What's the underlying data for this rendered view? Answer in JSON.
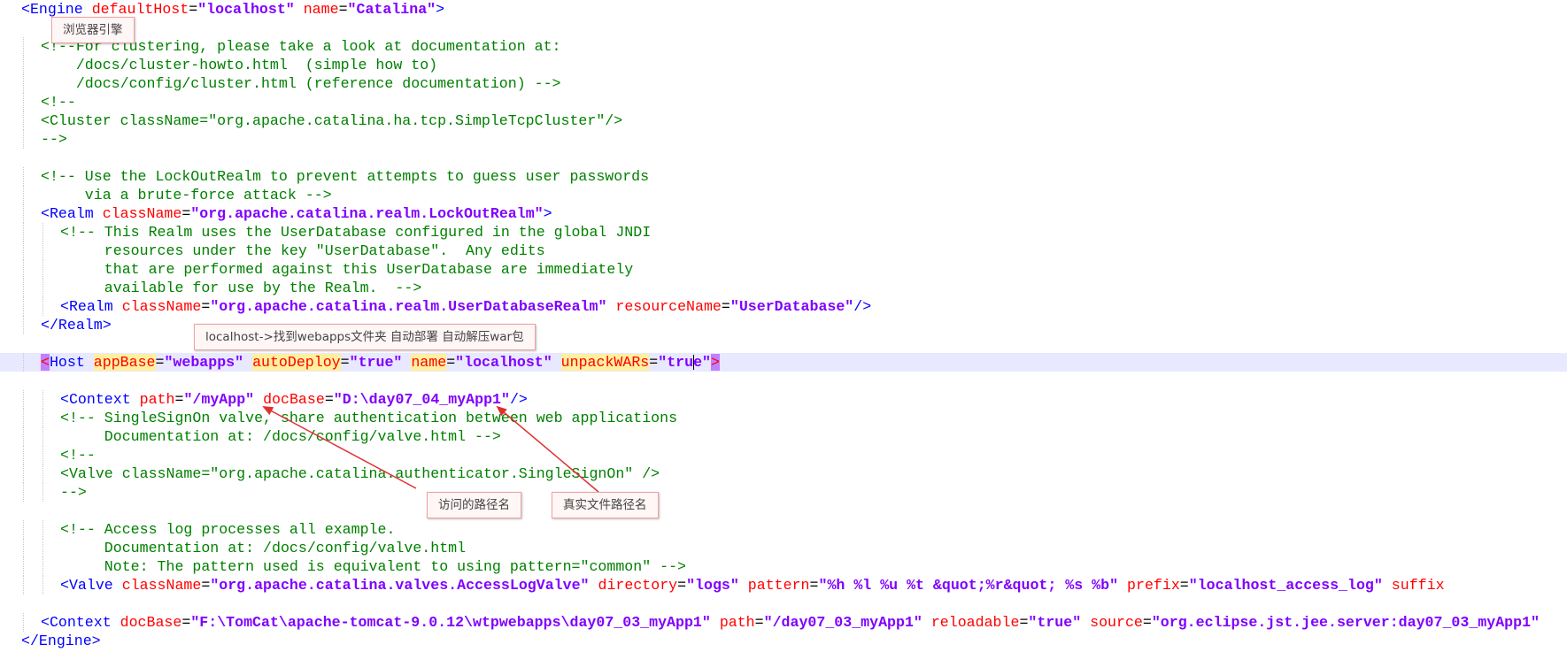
{
  "colors": {
    "tag": "#0000ff",
    "attribute": "#ff0000",
    "value": "#8000ff",
    "comment": "#008000",
    "current_line_bg": "#e8e8ff",
    "annotation_border": "#f0a0a0",
    "arrow": "#e03030"
  },
  "editor": {
    "lines": [
      {
        "tokens": [
          [
            "tag",
            "<Engine"
          ],
          [
            "p",
            " "
          ],
          [
            "attr",
            "defaultHost"
          ],
          [
            "p",
            "="
          ],
          [
            "val",
            "\"localhost\""
          ],
          [
            "p",
            " "
          ],
          [
            "attr",
            "name"
          ],
          [
            "p",
            "="
          ],
          [
            "val",
            "\"Catalina\""
          ],
          [
            "tag",
            ">"
          ]
        ]
      },
      {
        "tokens": []
      },
      {
        "tokens": [
          [
            "comment",
            "<!--For clustering, please take a look at documentation at:"
          ]
        ]
      },
      {
        "tokens": [
          [
            "comment",
            "    /docs/cluster-howto.html  (simple how to)"
          ]
        ]
      },
      {
        "tokens": [
          [
            "comment",
            "    /docs/config/cluster.html (reference documentation) -->"
          ]
        ]
      },
      {
        "tokens": [
          [
            "comment",
            "<!--"
          ]
        ]
      },
      {
        "tokens": [
          [
            "comment",
            "<Cluster className=\"org.apache.catalina.ha.tcp.SimpleTcpCluster\"/>"
          ]
        ]
      },
      {
        "tokens": [
          [
            "comment",
            "-->"
          ]
        ]
      },
      {
        "tokens": []
      },
      {
        "tokens": [
          [
            "comment",
            "<!-- Use the LockOutRealm to prevent attempts to guess user passwords"
          ]
        ]
      },
      {
        "tokens": [
          [
            "comment",
            "     via a brute-force attack -->"
          ]
        ]
      },
      {
        "tokens": [
          [
            "tag",
            "<Realm"
          ],
          [
            "p",
            " "
          ],
          [
            "attr",
            "className"
          ],
          [
            "p",
            "="
          ],
          [
            "val",
            "\"org.apache.catalina.realm.LockOutRealm\""
          ],
          [
            "tag",
            ">"
          ]
        ]
      },
      {
        "tokens": [
          [
            "comment",
            "<!-- This Realm uses the UserDatabase configured in the global JNDI"
          ]
        ]
      },
      {
        "tokens": [
          [
            "comment",
            "     resources under the key \"UserDatabase\".  Any edits"
          ]
        ]
      },
      {
        "tokens": [
          [
            "comment",
            "     that are performed against this UserDatabase are immediately"
          ]
        ]
      },
      {
        "tokens": [
          [
            "comment",
            "     available for use by the Realm.  -->"
          ]
        ]
      },
      {
        "tokens": [
          [
            "tag",
            "<Realm"
          ],
          [
            "p",
            " "
          ],
          [
            "attr",
            "className"
          ],
          [
            "p",
            "="
          ],
          [
            "val",
            "\"org.apache.catalina.realm.UserDatabaseRealm\""
          ],
          [
            "p",
            " "
          ],
          [
            "attr",
            "resourceName"
          ],
          [
            "p",
            "="
          ],
          [
            "val",
            "\"UserDatabase\""
          ],
          [
            "tag",
            "/>"
          ]
        ]
      },
      {
        "tokens": [
          [
            "tag",
            "</Realm>"
          ]
        ]
      },
      {
        "tokens": []
      },
      {
        "tokens": [
          [
            "brace",
            "<"
          ],
          [
            "tag",
            "Host"
          ],
          [
            "p",
            " "
          ],
          [
            "hlattr",
            "appBase"
          ],
          [
            "p",
            "="
          ],
          [
            "val",
            "\"webapps\""
          ],
          [
            "p",
            " "
          ],
          [
            "hlattr",
            "autoDeploy"
          ],
          [
            "p",
            "="
          ],
          [
            "val",
            "\"true\""
          ],
          [
            "p",
            " "
          ],
          [
            "hlattr",
            "name"
          ],
          [
            "p",
            "="
          ],
          [
            "val",
            "\"localhost\""
          ],
          [
            "p",
            " "
          ],
          [
            "hlattr",
            "unpackWARs"
          ],
          [
            "p",
            "="
          ],
          [
            "val",
            "\"true\""
          ],
          [
            "brace",
            ">"
          ]
        ]
      },
      {
        "tokens": []
      },
      {
        "tokens": [
          [
            "tag",
            "<Context"
          ],
          [
            "p",
            " "
          ],
          [
            "attr",
            "path"
          ],
          [
            "p",
            "="
          ],
          [
            "val",
            "\"/myApp\""
          ],
          [
            "p",
            " "
          ],
          [
            "attr",
            "docBase"
          ],
          [
            "p",
            "="
          ],
          [
            "val",
            "\"D:\\day07_04_myApp1\""
          ],
          [
            "tag",
            "/>"
          ]
        ]
      },
      {
        "tokens": [
          [
            "comment",
            "<!-- SingleSignOn valve, share authentication between web applications"
          ]
        ]
      },
      {
        "tokens": [
          [
            "comment",
            "     Documentation at: /docs/config/valve.html -->"
          ]
        ]
      },
      {
        "tokens": [
          [
            "comment",
            "<!--"
          ]
        ]
      },
      {
        "tokens": [
          [
            "comment",
            "<Valve className=\"org.apache.catalina.authenticator.SingleSignOn\" />"
          ]
        ]
      },
      {
        "tokens": [
          [
            "comment",
            "-->"
          ]
        ]
      },
      {
        "tokens": []
      },
      {
        "tokens": [
          [
            "comment",
            "<!-- Access log processes all example."
          ]
        ]
      },
      {
        "tokens": [
          [
            "comment",
            "     Documentation at: /docs/config/valve.html"
          ]
        ]
      },
      {
        "tokens": [
          [
            "comment",
            "     Note: The pattern used is equivalent to using pattern=\"common\" -->"
          ]
        ]
      },
      {
        "tokens": [
          [
            "tag",
            "<Valve"
          ],
          [
            "p",
            " "
          ],
          [
            "attr",
            "className"
          ],
          [
            "p",
            "="
          ],
          [
            "val",
            "\"org.apache.catalina.valves.AccessLogValve\""
          ],
          [
            "p",
            " "
          ],
          [
            "attr",
            "directory"
          ],
          [
            "p",
            "="
          ],
          [
            "val",
            "\"logs\""
          ],
          [
            "p",
            " "
          ],
          [
            "attr",
            "pattern"
          ],
          [
            "p",
            "="
          ],
          [
            "val",
            "\"%h %l %u %t &quot;%r&quot; %s %b\""
          ],
          [
            "p",
            " "
          ],
          [
            "attr",
            "prefix"
          ],
          [
            "p",
            "="
          ],
          [
            "val",
            "\"localhost_access_log\""
          ],
          [
            "p",
            " "
          ],
          [
            "attr",
            "suffix"
          ]
        ]
      },
      {
        "tokens": []
      },
      {
        "tokens": [
          [
            "tag",
            "<Context"
          ],
          [
            "p",
            " "
          ],
          [
            "attr",
            "docBase"
          ],
          [
            "p",
            "="
          ],
          [
            "val",
            "\"F:\\TomCat\\apache-tomcat-9.0.12\\wtpwebapps\\day07_03_myApp1\""
          ],
          [
            "p",
            " "
          ],
          [
            "attr",
            "path"
          ],
          [
            "p",
            "="
          ],
          [
            "val",
            "\"/day07_03_myApp1\""
          ],
          [
            "p",
            " "
          ],
          [
            "attr",
            "reloadable"
          ],
          [
            "p",
            "="
          ],
          [
            "val",
            "\"true\""
          ],
          [
            "p",
            " "
          ],
          [
            "attr",
            "source"
          ],
          [
            "p",
            "="
          ],
          [
            "val",
            "\"org.eclipse.jst.jee.server:day07_03_myApp1\""
          ]
        ]
      },
      {
        "tokens": [
          [
            "tag",
            "</Engine>"
          ]
        ]
      }
    ]
  },
  "annotations": {
    "engine": "浏览器引擎",
    "host": "localhost->找到webapps文件夹  自动部署  自动解压war包",
    "path": "访问的路径名",
    "docbase": "真实文件路径名"
  }
}
